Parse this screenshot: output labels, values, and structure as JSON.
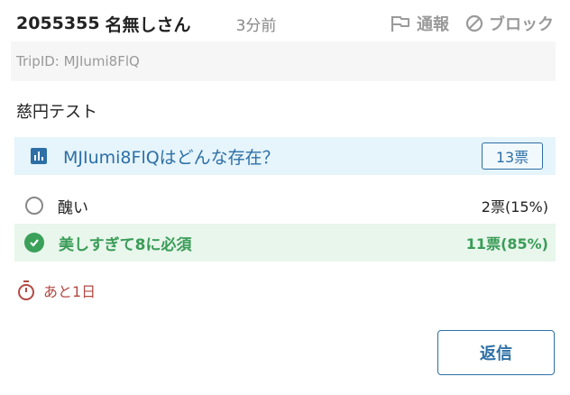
{
  "post": {
    "number": "2055355",
    "poster": "名無しさん",
    "time": "3分前",
    "report_label": "通報",
    "block_label": "ブロック",
    "trip": "TripID: MJIumi8FlQ",
    "body": "慈円テスト"
  },
  "poll": {
    "question": "MJIumi8FlQはどんな存在？",
    "total": "13票",
    "options": [
      {
        "label": "醜い",
        "result": "2票(15%)",
        "selected": false
      },
      {
        "label": "美しすぎて8に必須",
        "result": "11票(85%)",
        "selected": true
      }
    ],
    "remaining": "あと1日"
  },
  "actions": {
    "reply_label": "返信"
  },
  "colors": {
    "accent": "#2d6fa6",
    "selected": "#3a9c57",
    "timer": "#b24a44"
  }
}
